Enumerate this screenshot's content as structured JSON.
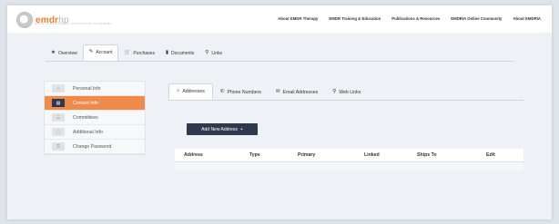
{
  "brand": {
    "name_main": "emdr",
    "name_light": "hp",
    "tagline": "EMDR HUMANITARIAN ASSISTANCE PROGRAMS"
  },
  "topnav": [
    "About EMDR Therapy",
    "EMDR Training & Education",
    "Publications & Resources",
    "EMDRIA Online Community",
    "About EMDRIA"
  ],
  "tabs": [
    {
      "label": "Overview",
      "icon": "star-icon"
    },
    {
      "label": "Account",
      "icon": "edit-icon"
    },
    {
      "label": "Purchases",
      "icon": "cart-icon"
    },
    {
      "label": "Documents",
      "icon": "file-icon"
    },
    {
      "label": "Links",
      "icon": "link-icon"
    }
  ],
  "sidebar": [
    {
      "label": "Personal Info",
      "icon": "user-icon"
    },
    {
      "label": "Contact Info",
      "icon": "address-card-icon"
    },
    {
      "label": "Committees",
      "icon": "group-icon"
    },
    {
      "label": "Additional Info",
      "icon": "info-icon"
    },
    {
      "label": "Change Password",
      "icon": "key-icon"
    }
  ],
  "subtabs": [
    {
      "label": "Addresses",
      "icon": "home-icon"
    },
    {
      "label": "Phone Numbers",
      "icon": "phone-icon"
    },
    {
      "label": "Email Addresses",
      "icon": "email-icon"
    },
    {
      "label": "Web Links",
      "icon": "link-icon"
    }
  ],
  "add_button": {
    "label": "Add New Address",
    "icon": "plus"
  },
  "table": {
    "columns": [
      "Address",
      "Type",
      "Primary",
      "Linked",
      "Ships To",
      "Edit"
    ]
  },
  "colors": {
    "accent": "#f08a4b",
    "dark": "#2e3a4c",
    "brand": "#e9822a"
  }
}
